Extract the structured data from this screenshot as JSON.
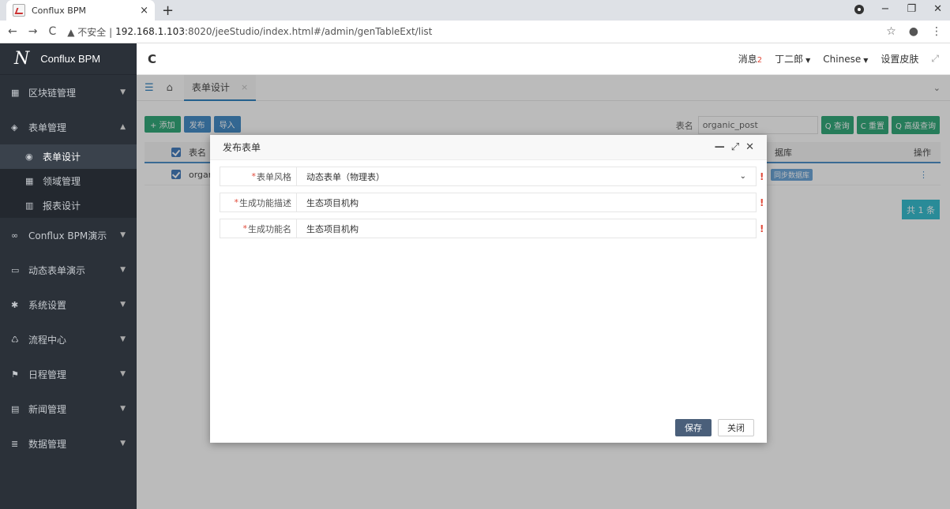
{
  "browser": {
    "tab_title": "Conflux BPM",
    "tab_close": "×",
    "new_tab": "+",
    "url_warning": "▲ 不安全 | ",
    "url_host": "192.168.1.103",
    "url_path": ":8020/jeeStudio/index.html#/admin/genTableExt/list"
  },
  "sidebar": {
    "logo_text": "Conflux BPM",
    "items": [
      {
        "label": "区块链管理",
        "icon": "grid-icon"
      },
      {
        "label": "表单管理",
        "icon": "cube-icon"
      },
      {
        "label": "Conflux BPM演示",
        "icon": "infinity-icon"
      },
      {
        "label": "动态表单演示",
        "icon": "monitor-icon"
      },
      {
        "label": "系统设置",
        "icon": "gear-icon"
      },
      {
        "label": "流程中心",
        "icon": "recycle-icon"
      },
      {
        "label": "日程管理",
        "icon": "flag-icon"
      },
      {
        "label": "新闻管理",
        "icon": "news-icon"
      },
      {
        "label": "数据管理",
        "icon": "database-icon"
      }
    ],
    "subitems": [
      {
        "label": "表单设计"
      },
      {
        "label": "领域管理"
      },
      {
        "label": "报表设计"
      }
    ]
  },
  "header": {
    "messages_label": "消息",
    "messages_count": "2",
    "user": "丁二郎",
    "language": "Chinese",
    "skin": "设置皮肤"
  },
  "tabs": {
    "active_tab": "表单设计"
  },
  "toolbar": {
    "add_label": "+ 添加",
    "publish_label": "发布",
    "import_label": "导入"
  },
  "search": {
    "label": "表名",
    "value": "organic_post",
    "query_label": "Q 查询",
    "reset_label": "C 重置",
    "advanced_label": "Q 高级查询"
  },
  "table": {
    "col_name": "表名",
    "col_db": "据库",
    "col_op": "操作",
    "row_name": "orgar",
    "row_sync": "同步数据库",
    "row_op": "⋮",
    "total": "共 1 条"
  },
  "modal": {
    "title": "发布表单",
    "fields": [
      {
        "label": "表单风格",
        "value": "动态表单（物理表）"
      },
      {
        "label": "生成功能描述",
        "value": "生态项目机构"
      },
      {
        "label": "生成功能名",
        "value": "生态项目机构"
      }
    ],
    "required_mark": "*",
    "error_mark": "!",
    "save_label": "保存",
    "close_label": "关闭"
  }
}
